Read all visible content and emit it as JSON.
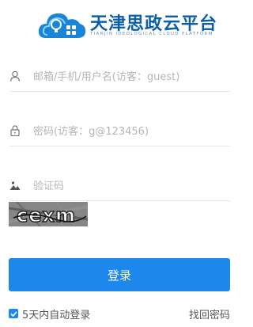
{
  "brand": {
    "title": "天津思政云平台",
    "subtitle": "TIANJIN IDEOLOGICAL CLOUD PLATFORM"
  },
  "form": {
    "username_placeholder": "邮箱/手机/用户名(访客：guest)",
    "password_placeholder": "密码(访客：g@123456)",
    "captcha_placeholder": "验证码",
    "captcha_text": "cexm",
    "login_label": "登录",
    "remember_label": "5天内自动登录",
    "remember_checked": true,
    "forgot_label": "找回密码"
  },
  "colors": {
    "primary": "#1d87ec",
    "brand": "#0b5fa8"
  }
}
